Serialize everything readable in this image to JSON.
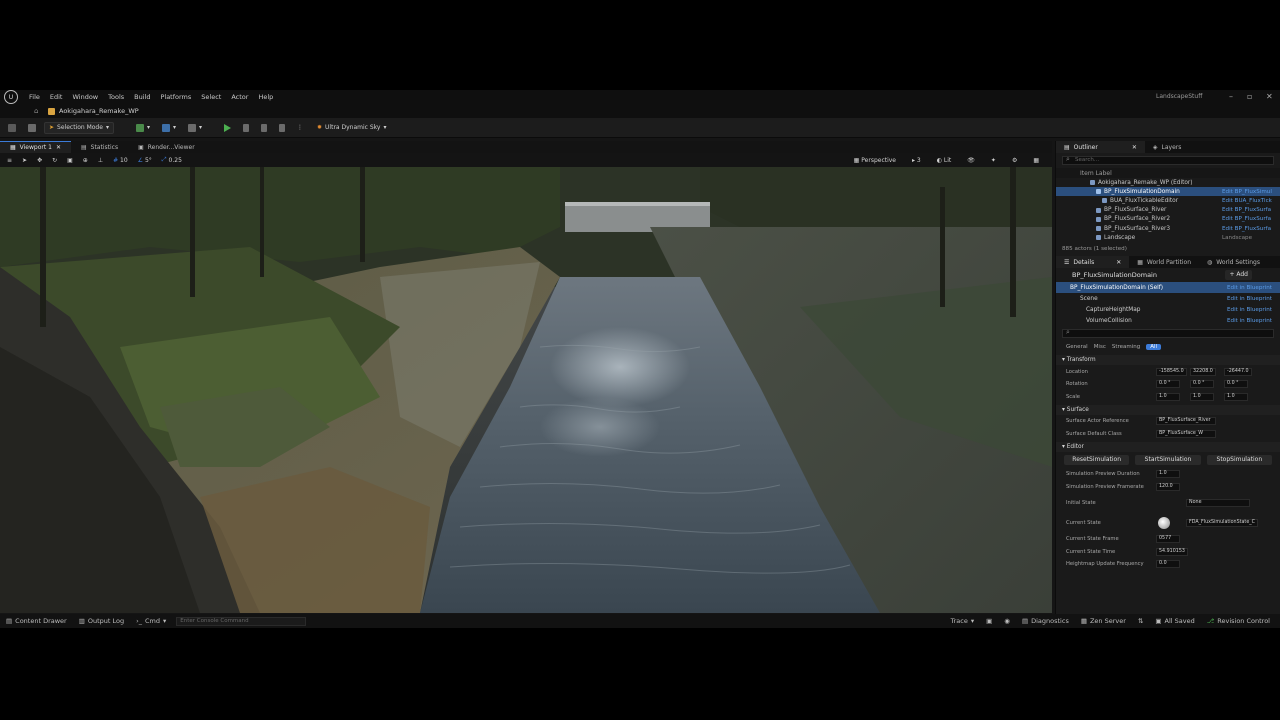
{
  "menubar": {
    "items": [
      "File",
      "Edit",
      "Window",
      "Tools",
      "Build",
      "Platforms",
      "Select",
      "Actor",
      "Help"
    ],
    "project": "LandscapeStuff"
  },
  "level": {
    "name": "Aokigahara_Remake_WP"
  },
  "toolbar": {
    "mode": "Selection Mode",
    "lighting": "Ultra Dynamic Sky"
  },
  "viewport": {
    "tabs": [
      "Viewport 1",
      "Statistics",
      "Render...Viewer"
    ],
    "view_mode": "Perspective",
    "lit": "Lit",
    "grid_snap": "10",
    "rot_snap": "5°",
    "scale_snap": "0.25",
    "camera_speed": "3"
  },
  "statusbar": {
    "content_drawer": "Content Drawer",
    "output_log": "Output Log",
    "cmd": "Cmd",
    "cmd_placeholder": "Enter Console Command",
    "trace": "Trace",
    "diagnostics": "Diagnostics",
    "zen": "Zen Server",
    "saved": "All Saved",
    "revision": "Revision Control"
  },
  "outliner": {
    "tabs": [
      "Outliner",
      "Layers"
    ],
    "search_placeholder": "Search...",
    "col_label": "Item Label",
    "col_type": "Type",
    "rows": [
      {
        "label": "Aokigahara_Remake_WP (Editor)",
        "type": ""
      },
      {
        "label": "BP_FluxSimulationDomain",
        "type": "Edit BP_FluxSimul"
      },
      {
        "label": "BUA_FluxTickableEditor",
        "type": "Edit BUA_FluxTick"
      },
      {
        "label": "BP_FluxSurface_River",
        "type": "Edit BP_FluxSurfa"
      },
      {
        "label": "BP_FluxSurface_River2",
        "type": "Edit BP_FluxSurfa"
      },
      {
        "label": "BP_FluxSurface_River3",
        "type": "Edit BP_FluxSurfa"
      },
      {
        "label": "Landscape",
        "type": "Landscape"
      }
    ],
    "count": "885 actors (1 selected)"
  },
  "details": {
    "tabs": [
      "Details",
      "World Partition",
      "World Settings"
    ],
    "actor": "BP_FluxSimulationDomain",
    "add": "+ Add",
    "components": [
      {
        "label": "BP_FluxSimulationDomain (Self)",
        "edit": "Edit in Blueprint"
      },
      {
        "label": "Scene",
        "edit": "Edit in Blueprint"
      },
      {
        "label": "CaptureHeightMap",
        "edit": "Edit in Blueprint"
      },
      {
        "label": "VolumeCollision",
        "edit": "Edit in Blueprint"
      }
    ],
    "filters": [
      "General",
      "Misc",
      "Streaming",
      "All"
    ],
    "transform": {
      "section": "Transform",
      "location_label": "Location",
      "location": [
        "-158545.0",
        "32208.0",
        "-26447.0"
      ],
      "rotation_label": "Rotation",
      "rotation": [
        "0.0 °",
        "0.0 °",
        "0.0 °"
      ],
      "scale_label": "Scale",
      "scale": [
        "1.0",
        "1.0",
        "1.0"
      ]
    },
    "surface": {
      "section": "Surface",
      "ref_label": "Surface Actor Reference",
      "ref_value": "BP_FluxSurface_River",
      "default_label": "Surface Default Class",
      "default_value": "BP_FluxSurface_W"
    },
    "editor": {
      "section": "Editor",
      "buttons": [
        "ResetSimulation",
        "StartSimulation",
        "StopSimulation"
      ],
      "props": [
        {
          "label": "Simulation Preview Duration",
          "value": "1.0"
        },
        {
          "label": "Simulation Preview Framerate",
          "value": "120.0"
        },
        {
          "label": "Initial State",
          "value": "None"
        },
        {
          "label": "Current State",
          "value": "FDA_FluxSimulationState_C"
        },
        {
          "label": "Current State Frame",
          "value": "0577"
        },
        {
          "label": "Current State Time",
          "value": "54.910153"
        },
        {
          "label": "Heightmap Update Frequency",
          "value": "0.0"
        }
      ]
    }
  },
  "colors": {
    "accent": "#3c7bd8",
    "selection": "#2b4f7e",
    "link": "#5a9be6"
  }
}
